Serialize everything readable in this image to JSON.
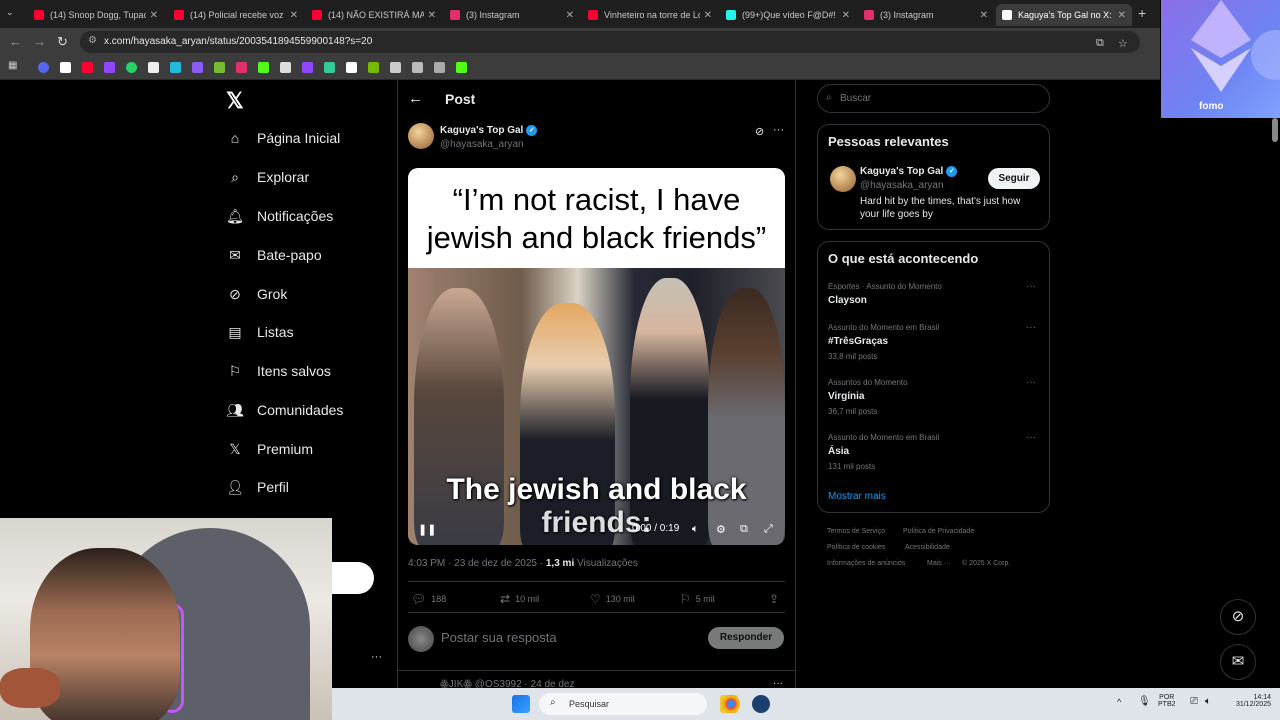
{
  "browser": {
    "tabs": [
      {
        "label": "(14) Snoop Dogg, Tupac",
        "icon": "youtube-icon",
        "color": "#ff0033"
      },
      {
        "label": "(14) Policial recebe voz de",
        "icon": "youtube-icon",
        "color": "#ff0033"
      },
      {
        "label": "(14) NÃO EXISTIRÁ MAIS",
        "icon": "youtube-icon",
        "color": "#ff0033"
      },
      {
        "label": "(3) Instagram",
        "icon": "instagram-icon",
        "color": "#e1306c"
      },
      {
        "label": "Vinheteiro na torre de Lo",
        "icon": "youtube-icon",
        "color": "#ff0033"
      },
      {
        "label": "(99+)Que vídeo F@D#! 👏",
        "icon": "tiktok-icon",
        "color": "#25f4ee"
      },
      {
        "label": "(3) Instagram",
        "icon": "instagram-icon",
        "color": "#e1306c"
      },
      {
        "label": "Kaguya's Top Gal no X:",
        "icon": "x-icon",
        "color": "#ffffff"
      }
    ],
    "url": "x.com/hayasaka_aryan/status/2003541894559900148?s=20",
    "overlay_label": "fomo"
  },
  "nav": {
    "items": [
      {
        "label": "Página Inicial",
        "icon": "home-icon"
      },
      {
        "label": "Explorar",
        "icon": "search-icon"
      },
      {
        "label": "Notificações",
        "icon": "bell-icon"
      },
      {
        "label": "Bate-papo",
        "icon": "mail-icon"
      },
      {
        "label": "Grok",
        "icon": "grok-icon"
      },
      {
        "label": "Listas",
        "icon": "list-icon"
      },
      {
        "label": "Itens salvos",
        "icon": "bookmark-icon"
      },
      {
        "label": "Comunidades",
        "icon": "communities-icon"
      },
      {
        "label": "Premium",
        "icon": "x-icon"
      },
      {
        "label": "Perfil",
        "icon": "profile-icon"
      }
    ]
  },
  "post": {
    "header_title": "Post",
    "author_name": "Kaguya's Top Gal",
    "author_handle": "@hayasaka_aryan",
    "media_caption_line1": "“I’m not racist, I have",
    "media_caption_line2": "jewish and black friends”",
    "subtitle_line1": "The jewish and black",
    "subtitle_line2": "friends:",
    "video_time": "0:00 / 0:19",
    "meta_time": "4:03 PM · 23 de dez de 2025 · ",
    "meta_views_count": "1,3 mi",
    "meta_views_label": " Visualizações",
    "stats": {
      "replies": "188",
      "reposts": "10 mil",
      "likes": "130 mil",
      "bookmarks": "5 mil"
    },
    "reply_placeholder": "Postar sua resposta",
    "reply_button": "Responder",
    "next_reply_preview": "ꙮJIKꙮ @OS3992 · 24 de dez"
  },
  "sidebar": {
    "search_placeholder": "Buscar",
    "relevant_title": "Pessoas relevantes",
    "relevant_name": "Kaguya's Top Gal",
    "relevant_handle": "@hayasaka_aryan",
    "relevant_bio": "Hard hit by the times, that's just how your life goes by",
    "follow_label": "Seguir",
    "trends_title": "O que está acontecendo",
    "trends": [
      {
        "category": "Esportes · Assunto do Momento",
        "name": "Clayson",
        "count": ""
      },
      {
        "category": "Assunto do Momento em Brasil",
        "name": "#TrêsGraças",
        "count": "33,8 mil posts"
      },
      {
        "category": "Assuntos do Momento",
        "name": "Virgínia",
        "count": "36,7 mil posts"
      },
      {
        "category": "Assunto do Momento em Brasil",
        "name": "Ásia",
        "count": "131 mil posts"
      }
    ],
    "show_more": "Mostrar mais",
    "footer": {
      "terms": "Termos de Serviço",
      "privacy": "Política de Privacidade",
      "cookies": "Política de cookies",
      "accessibility": "Acessibilidade",
      "ads": "Informações de anúncios",
      "more": "Mais ···",
      "copyright": "© 2025 X Corp."
    }
  },
  "taskbar": {
    "search_placeholder": "Pesquisar",
    "lang_top": "POR",
    "lang_bottom": "PTB2",
    "time": "14:14",
    "date": "31/12/2025"
  },
  "colors": {
    "accent": "#1d9bf0",
    "background": "#000000",
    "border": "#2f3336"
  }
}
